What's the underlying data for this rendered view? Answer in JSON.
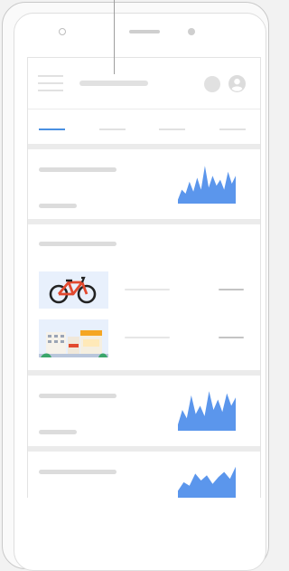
{
  "colors": {
    "accent": "#4a90e2",
    "sparkline": "#5b96ec",
    "placeholder": "#dcdcdc",
    "bike_frame": "#e2492f",
    "store_awning": "#f5a623"
  },
  "icons": {
    "menu": "menu-icon",
    "circle": "notification-icon",
    "avatar": "account-icon"
  },
  "appbar": {
    "title": ""
  },
  "tabs": [
    {
      "label": "",
      "active": true
    },
    {
      "label": "",
      "active": false
    },
    {
      "label": "",
      "active": false
    },
    {
      "label": "",
      "active": false
    }
  ],
  "cards": [
    {
      "type": "sparkline",
      "sparkline": [
        0.1,
        0.35,
        0.25,
        0.55,
        0.3,
        0.65,
        0.35,
        0.95,
        0.4,
        0.7,
        0.45,
        0.6,
        0.35,
        0.8,
        0.5,
        0.7
      ]
    },
    {
      "type": "image-list",
      "items": [
        {
          "image": "bicycle"
        },
        {
          "image": "storefront"
        }
      ]
    },
    {
      "type": "sparkline",
      "sparkline": [
        0.15,
        0.5,
        0.3,
        0.85,
        0.4,
        0.6,
        0.35,
        0.95,
        0.5,
        0.75,
        0.45,
        0.9,
        0.6,
        0.8
      ]
    },
    {
      "type": "sparkline",
      "sparkline": [
        0.2,
        0.45,
        0.35,
        0.7,
        0.5,
        0.65,
        0.4,
        0.6,
        0.75,
        0.55,
        0.9
      ]
    }
  ]
}
